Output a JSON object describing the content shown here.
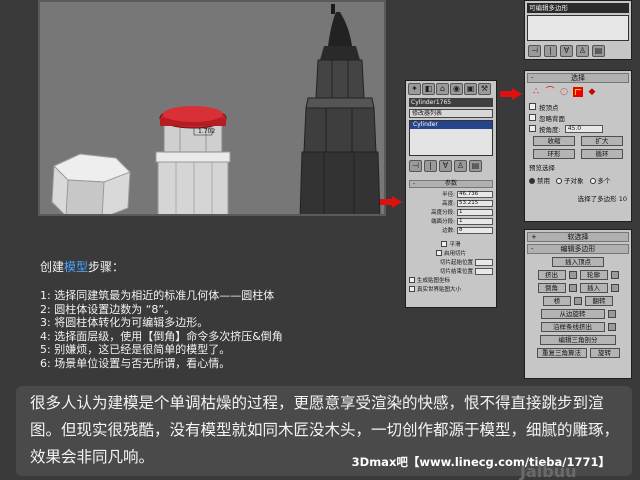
{
  "viewport": {
    "label_fragments": [
      "1.702",
      "",
      "",
      ""
    ]
  },
  "modify_panel": {
    "object_name": "Cylinder1765",
    "modifier_list": "修改器列表",
    "stack_item": "Cylinder",
    "params_title": "参数",
    "params": [
      {
        "label": "半径:",
        "value": "46.736"
      },
      {
        "label": "高度:",
        "value": "53.215"
      },
      {
        "label": "高度分段:",
        "value": "1"
      },
      {
        "label": "端面分段:",
        "value": "1"
      },
      {
        "label": "边数:",
        "value": "8"
      }
    ],
    "checks": [
      "平滑",
      "启用切片"
    ],
    "slice_from": "切片起始位置",
    "slice_to": "切片结束位置",
    "gen_map": "生成贴图坐标",
    "real_world": "真实世界贴图大小"
  },
  "top_right": {
    "name": "可编辑多边形"
  },
  "selection": {
    "title": "选择",
    "icons": [
      "vertex-icon",
      "edge-icon",
      "border-icon",
      "polygon-icon",
      "element-icon"
    ],
    "checks": {
      "by_vertex": "按顶点",
      "ignore_backface": "忽略背面",
      "by_angle": "按角度:",
      "angle_value": "45.0"
    },
    "buttons": {
      "shrink": "收缩",
      "grow": "扩大",
      "ring": "环形",
      "loop": "循环"
    },
    "preview_title": "预览选择",
    "preview_options": [
      "禁用",
      "子对象",
      "多个"
    ],
    "status": "选择了多边形 10"
  },
  "edit_panel": {
    "soft_selection": "软选择",
    "edit_polygons": "编辑多边形",
    "insert_vertex": "插入顶点",
    "extrude": "挤出",
    "outline": "轮廓",
    "bevel": "倒角",
    "inset": "插入",
    "bridge": "桥",
    "flip": "翻转",
    "hinge": "从边旋转",
    "extrude_spline": "沿样条线挤出",
    "edit_tri": "编辑三角剖分",
    "retri": "重复三角算法",
    "turn": "旋转"
  },
  "steps": {
    "title_prefix": "创建",
    "title_highlight": "模型",
    "title_suffix": "步骤：",
    "lines": [
      "1: 选择同建筑最为相近的标准几何体——圆柱体",
      "2: 圆柱体设置边数为 “8”。",
      "3: 将圆柱体转化为可编辑多边形。",
      "4: 选择面层级，使用【倒角】命令多次挤压&倒角",
      "5: 别嫌烦，这已经是很简单的模型了。",
      "6: 场景单位设置与否无所谓，看心情。"
    ]
  },
  "bottom": {
    "paragraph": "很多人认为建模是个单调枯燥的过程，更愿意享受渲染的快感，恨不得直接跳步到渲图。但现实很残酷，没有模型就如同木匠没木头，一切创作都源于模型，细腻的雕琢，效果会非同凡响。",
    "watermark": "3Dmax吧【www.linecg.com/tieba/1771】",
    "logo": "Jaibuu"
  }
}
